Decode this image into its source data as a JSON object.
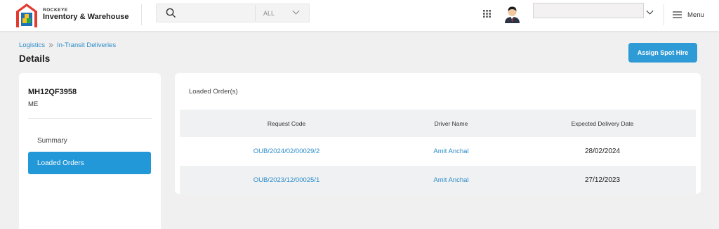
{
  "header": {
    "brand_small": "ROCKEYE",
    "brand_name": "Inventory & Warehouse",
    "search": {
      "placeholder": "",
      "scope": "ALL"
    },
    "menu_label": "Menu"
  },
  "breadcrumb": [
    "Logistics",
    "In-Transit Deliveries"
  ],
  "page_title": "Details",
  "actions": {
    "assign_label": "Assign Spot Hire"
  },
  "vehicle": {
    "number": "MH12QF3958",
    "type": "ME"
  },
  "sidebar": {
    "items": [
      {
        "label": "Summary",
        "active": false
      },
      {
        "label": "Loaded Orders",
        "active": true
      }
    ]
  },
  "loaded_orders": {
    "title": "Loaded Order(s)",
    "columns": [
      "Request Code",
      "Driver Name",
      "Expected Delivery Date"
    ],
    "rows": [
      {
        "request_code": "OUB/2024/02/00029/2",
        "driver": "Amit Anchal",
        "date": "28/02/2024"
      },
      {
        "request_code": "OUB/2023/12/00025/1",
        "driver": "Amit Anchal",
        "date": "27/12/2023"
      }
    ]
  },
  "colors": {
    "accent": "#2e9ad6",
    "link": "#2a8bc9",
    "background": "#f0f0f0"
  }
}
